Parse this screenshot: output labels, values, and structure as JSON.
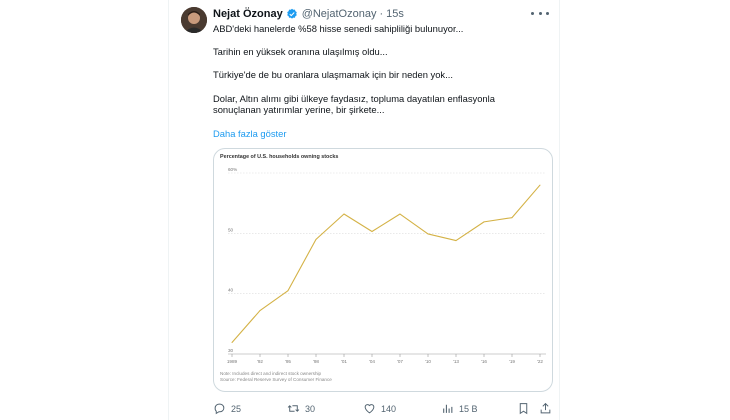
{
  "tweet": {
    "author_name": "Nejat Özonay",
    "handle": "@NejatOzonay",
    "separator": "·",
    "time": "15s",
    "paragraphs": [
      "ABD'deki hanelerde %58 hisse senedi sahipliliği bulunuyor...",
      "Tarihin en yüksek oranına ulaşılmış oldu...",
      "Türkiye'de de bu oranlara ulaşmamak için bir neden yok...",
      "Dolar, Altın alımı gibi ülkeye faydasız, topluma dayatılan enflasyonla\nsonuçlanan yatırımlar yerine, bir şirkete..."
    ],
    "show_more": "Daha fazla göster"
  },
  "actions": {
    "replies": "25",
    "retweets": "30",
    "likes": "140",
    "views": "15 B"
  },
  "icons": {
    "verified": "verified-badge-icon",
    "more": "more-options-icon",
    "reply": "reply-icon",
    "retweet": "retweet-icon",
    "like": "heart-icon",
    "views": "views-chart-icon",
    "bookmark": "bookmark-icon",
    "share": "share-icon"
  },
  "colors": {
    "accent": "#1d9bf0",
    "line": "#d4b246",
    "muted": "#536471"
  },
  "chart_data": {
    "type": "line",
    "title": "Percentage of U.S. households owning stocks",
    "x": [
      "1989",
      "'92",
      "'95",
      "'98",
      "'01",
      "'04",
      "'07",
      "'10",
      "'13",
      "'16",
      "'19",
      "'22"
    ],
    "series": [
      {
        "values": [
          31.9,
          37.2,
          40.5,
          49.0,
          53.2,
          50.3,
          53.2,
          49.9,
          48.8,
          51.9,
          52.6,
          58.0
        ]
      }
    ],
    "y_ticks": [
      "60%",
      "50",
      "40",
      "30"
    ],
    "ylim": [
      30,
      60
    ],
    "grid": true,
    "note": "Note: Includes direct and indirect stock ownership",
    "source": "Source: Federal Reserve Survey of Consumer Finance"
  }
}
